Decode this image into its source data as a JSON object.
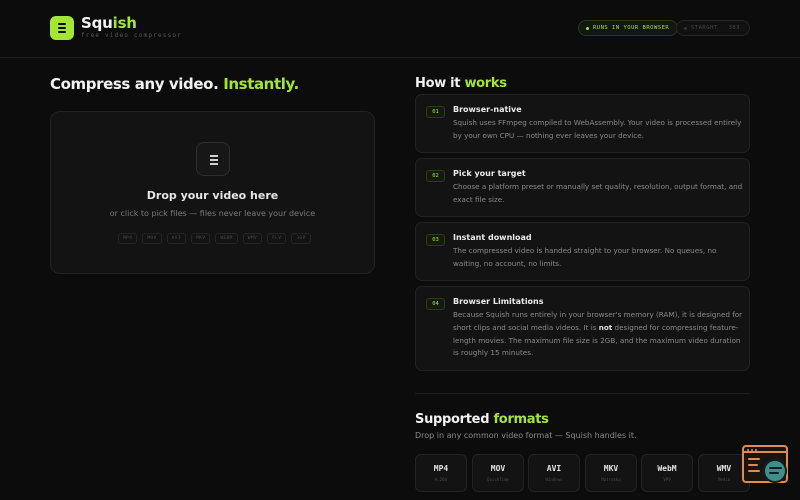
{
  "header": {
    "brand_prefix": "Squ",
    "brand_accent": "ish",
    "tagline": "free video compressor",
    "runs_badge": "RUNS IN YOUR BROWSER",
    "star_label": "STARGHT",
    "star_count": "383"
  },
  "hero": {
    "heading": "Compress any video.",
    "heading_accent": "Instantly."
  },
  "dropzone": {
    "title": "Drop your video here",
    "subtitle": "or click to pick files — files never leave your device",
    "formats": [
      "MP4",
      "MOV",
      "AVI",
      "MKV",
      "WEBM",
      "WMV",
      "FLV",
      "3GP"
    ]
  },
  "how_it_works": {
    "heading": "How it",
    "heading_accent": "works",
    "steps": [
      {
        "num": "01",
        "title": "Browser-native",
        "desc": "Squish uses FFmpeg compiled to WebAssembly. Your video is processed entirely by your own CPU — nothing ever leaves your device."
      },
      {
        "num": "02",
        "title": "Pick your target",
        "desc": "Choose a platform preset or manually set quality, resolution, output format, and exact file size."
      },
      {
        "num": "03",
        "title": "Instant download",
        "desc": "The compressed video is handed straight to your browser. No queues, no waiting, no account, no limits."
      },
      {
        "num": "04",
        "title": "Browser Limitations",
        "desc_before": "Because Squish runs entirely in your browser's memory (RAM), it is designed for short clips and social media videos. It is ",
        "desc_bold": "not",
        "desc_after": " designed for compressing feature-length movies. The maximum file size is 2GB, and the maximum video duration is roughly 15 minutes."
      }
    ]
  },
  "supported": {
    "heading": "Supported",
    "heading_accent": "formats",
    "subtitle": "Drop in any common video format — Squish handles it.",
    "cards": [
      {
        "ext": "MP4",
        "codec": "H.264"
      },
      {
        "ext": "MOV",
        "codec": "QuickTime"
      },
      {
        "ext": "AVI",
        "codec": "Windows"
      },
      {
        "ext": "MKV",
        "codec": "Matroska"
      },
      {
        "ext": "WebM",
        "codec": "VP9"
      },
      {
        "ext": "WMV",
        "codec": "Media"
      }
    ]
  },
  "colors": {
    "accent": "#a3e635",
    "background": "#0c0c0c",
    "widget": "#e38b4f"
  }
}
